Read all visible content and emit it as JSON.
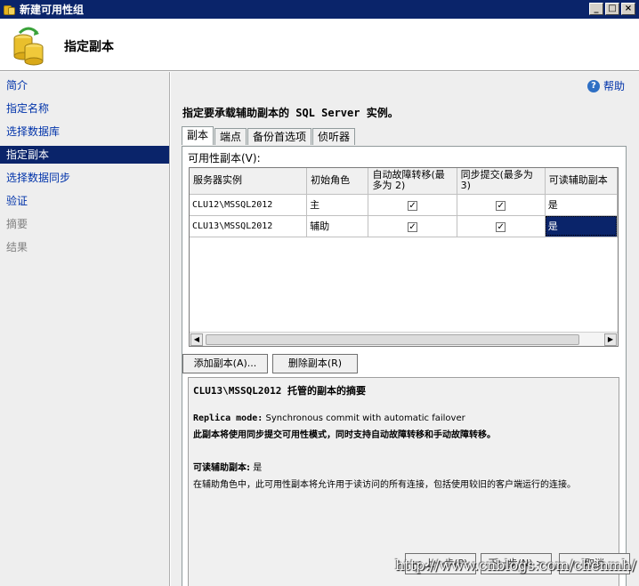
{
  "window": {
    "title": "新建可用性组",
    "min": "_",
    "max": "□",
    "close": "×"
  },
  "header": {
    "heading": "指定副本"
  },
  "nav": {
    "items": [
      {
        "label": "简介",
        "state": "normal"
      },
      {
        "label": "指定名称",
        "state": "normal"
      },
      {
        "label": "选择数据库",
        "state": "normal"
      },
      {
        "label": "指定副本",
        "state": "active"
      },
      {
        "label": "选择数据同步",
        "state": "normal"
      },
      {
        "label": "验证",
        "state": "normal"
      },
      {
        "label": "摘要",
        "state": "disabled"
      },
      {
        "label": "结果",
        "state": "disabled"
      }
    ]
  },
  "main": {
    "help_label": "帮助",
    "help_icon": "?",
    "instruction": "指定要承载辅助副本的 SQL Server 实例。",
    "tabs": [
      "副本",
      "端点",
      "备份首选项",
      "侦听器"
    ],
    "replica_label": "可用性副本(V):",
    "grid": {
      "columns": [
        "服务器实例",
        "初始角色",
        "自动故障转移(最多为 2)",
        "同步提交(最多为 3)",
        "可读辅助副本"
      ],
      "rows": [
        {
          "server": "CLU12\\MSSQL2012",
          "role": "主",
          "auto_failover": "✓",
          "sync_commit": "✓",
          "readable": "是"
        },
        {
          "server": "CLU13\\MSSQL2012",
          "role": "辅助",
          "auto_failover": "✓",
          "sync_commit": "✓",
          "readable": "是"
        }
      ]
    },
    "add_button": "添加副本(A)...",
    "remove_button": "删除副本(R)",
    "summary": {
      "title": "CLU13\\MSSQL2012 托管的副本的摘要",
      "mode_label": "Replica mode:",
      "mode_value": "Synchronous commit with automatic failover",
      "mode_desc": "此副本将使用同步提交可用性模式，同时支持自动故障转移和手动故障转移。",
      "readable_label": "可读辅助副本:",
      "readable_value": "是",
      "readable_desc": "在辅助角色中，此可用性副本将允许用于读访问的所有连接，包括使用较旧的客户端运行的连接。"
    }
  },
  "footer": {
    "prev": "< 上一步(P)",
    "next": "下一步(N) >",
    "cancel": "取消",
    "watermark": "http://www.cnblogs.com/chenmh/"
  }
}
